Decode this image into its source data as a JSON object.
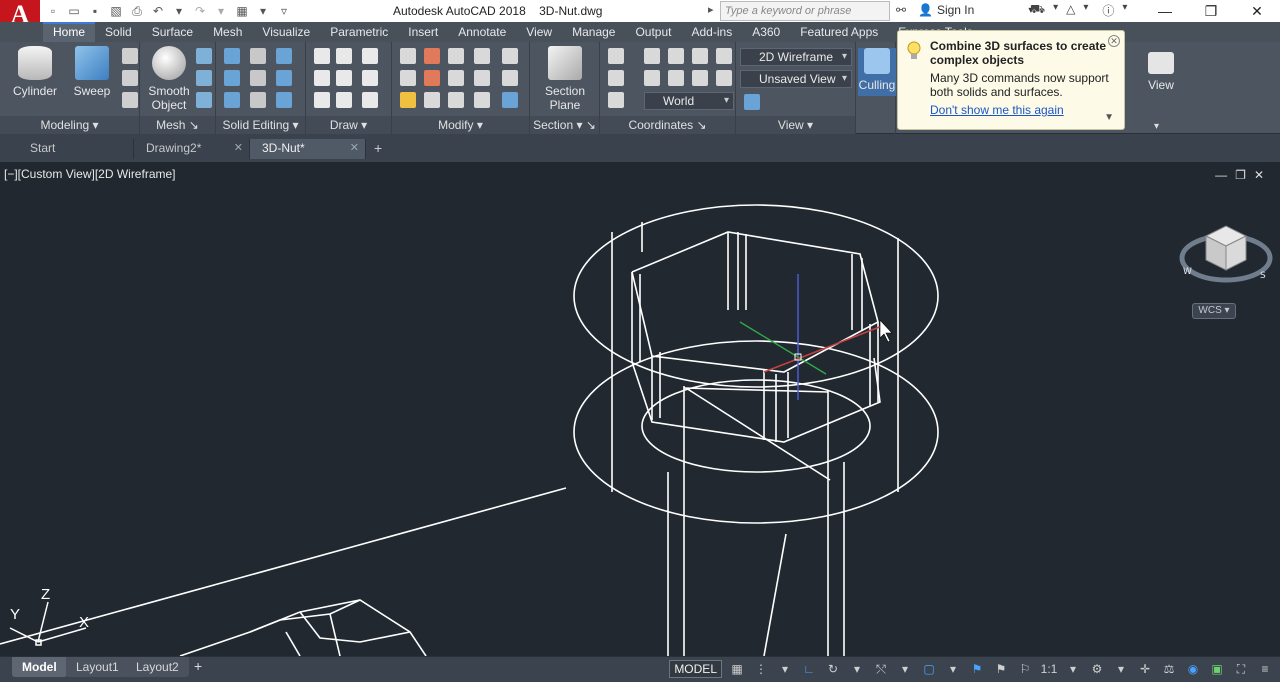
{
  "app": {
    "logo_letter": "A",
    "title": "Autodesk AutoCAD 2018",
    "document": "3D-Nut.dwg",
    "search_placeholder": "Type a keyword or phrase",
    "signin_label": "Sign In"
  },
  "ribbon_tabs": [
    "Home",
    "Solid",
    "Surface",
    "Mesh",
    "Visualize",
    "Parametric",
    "Insert",
    "Annotate",
    "View",
    "Manage",
    "Output",
    "Add-ins",
    "A360",
    "Featured Apps",
    "Express Tools"
  ],
  "ribbon": {
    "modeling": {
      "cylinder": "Cylinder",
      "sweep": "Sweep",
      "title": "Modeling"
    },
    "mesh": {
      "smooth_object_line1": "Smooth",
      "smooth_object_line2": "Object",
      "title": "Mesh"
    },
    "solid_editing": {
      "title": "Solid Editing"
    },
    "draw": {
      "title": "Draw"
    },
    "modify": {
      "title": "Modify"
    },
    "section": {
      "section_plane_line1": "Section",
      "section_plane_line2": "Plane",
      "title": "Section"
    },
    "coordinates": {
      "title": "Coordinates",
      "world": "World"
    },
    "view": {
      "visual_style": "2D Wireframe",
      "named_view": "Unsaved View",
      "title": "View"
    },
    "culling": "Culling",
    "view_big": "View"
  },
  "tip": {
    "title": "Combine 3D surfaces to create complex objects",
    "body": "Many 3D commands now support both solids and surfaces.",
    "link": "Don't show me this again"
  },
  "file_tabs": [
    {
      "label": "Start"
    },
    {
      "label": "Drawing2*"
    },
    {
      "label": "3D-Nut*"
    }
  ],
  "viewport": {
    "label": "[−][Custom View][2D Wireframe]",
    "wcs": "WCS",
    "ucs_z": "Z",
    "ucs_y": "Y",
    "ucs_x": "X"
  },
  "status": {
    "layouts": [
      "Model",
      "Layout1",
      "Layout2"
    ],
    "model_label": "MODEL",
    "scale": "1:1"
  },
  "colors": {
    "ribbon_bg": "#4d5561",
    "viewport_bg": "#212830",
    "wire": "#ffffff",
    "accent": "#3a7bd5",
    "logo_red": "#c4161c"
  }
}
